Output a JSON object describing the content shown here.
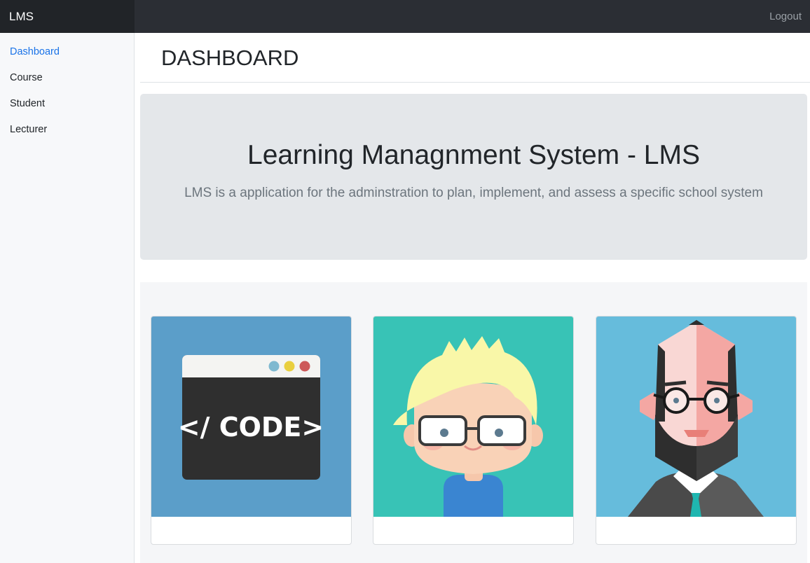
{
  "app": {
    "brand": "LMS",
    "logout_label": "Logout"
  },
  "sidebar": {
    "items": [
      {
        "label": "Dashboard",
        "active": true
      },
      {
        "label": "Course",
        "active": false
      },
      {
        "label": "Student",
        "active": false
      },
      {
        "label": "Lecturer",
        "active": false
      }
    ]
  },
  "main": {
    "page_title": "DASHBOARD",
    "jumbotron": {
      "title": "Learning Managnment System - LMS",
      "lead": "LMS is a application for the adminstration to plan, implement, and assess a specific school system"
    },
    "cards": [
      {
        "icon": "code-window-icon",
        "code_text": "</ CODE>"
      },
      {
        "icon": "student-avatar-icon"
      },
      {
        "icon": "lecturer-avatar-icon"
      }
    ]
  },
  "colors": {
    "accent": "#1a73e8",
    "topbar": "#2b2e34",
    "brand_bg": "#212428",
    "jumbotron_bg": "#e4e7ea",
    "card1_bg": "#5b9ec9",
    "card2_bg": "#38c3b6",
    "card3_bg": "#66bcdc"
  }
}
